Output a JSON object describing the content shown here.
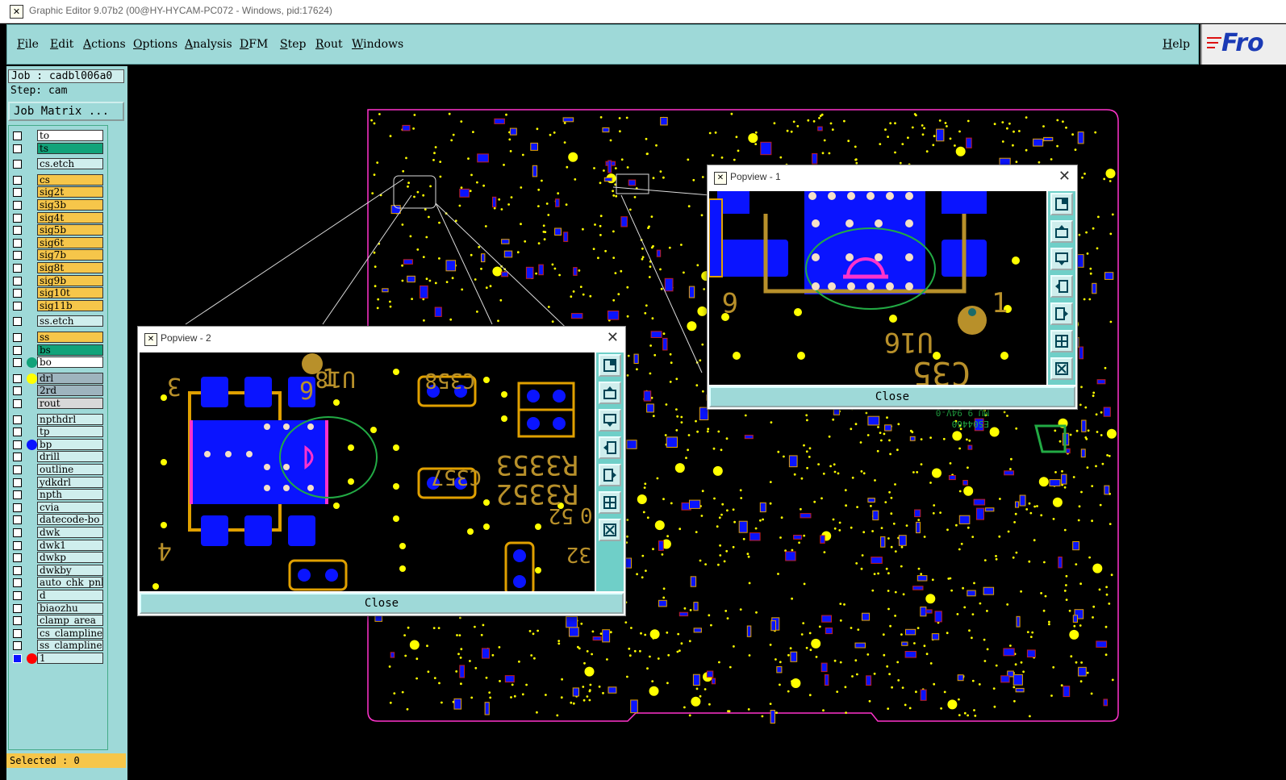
{
  "window": {
    "title": "Graphic Editor 9.07b2 (00@HY-HYCAM-PC072 - Windows, pid:17624)"
  },
  "menu": {
    "items": [
      "File",
      "Edit",
      "Actions",
      "Options",
      "Analysis",
      "DFM",
      "Step",
      "Rout",
      "Windows"
    ],
    "help": "Help"
  },
  "logo": {
    "text": "Fro"
  },
  "job": {
    "job_label": "Job : cadbl006a0",
    "step_label": "Step: cam",
    "matrix_button": "Job Matrix ..."
  },
  "layers": [
    {
      "name": "to",
      "color": "#ffffff"
    },
    {
      "name": "ts",
      "color": "#12a37a"
    },
    {
      "name": "cs.etch",
      "color": "#cfeeed"
    },
    {
      "name": "cs",
      "color": "#f6c64a"
    },
    {
      "name": "sig2t",
      "color": "#f6c64a"
    },
    {
      "name": "sig3b",
      "color": "#f6c64a"
    },
    {
      "name": "sig4t",
      "color": "#f6c64a"
    },
    {
      "name": "sig5b",
      "color": "#f6c64a"
    },
    {
      "name": "sig6t",
      "color": "#f6c64a"
    },
    {
      "name": "sig7b",
      "color": "#f6c64a"
    },
    {
      "name": "sig8t",
      "color": "#f6c64a"
    },
    {
      "name": "sig9b",
      "color": "#f6c64a"
    },
    {
      "name": "sig10t",
      "color": "#f6c64a"
    },
    {
      "name": "sig11b",
      "color": "#f6c64a"
    },
    {
      "name": "ss.etch",
      "color": "#cfeeed"
    },
    {
      "name": "ss",
      "color": "#f6c64a"
    },
    {
      "name": "bs",
      "color": "#12a37a"
    },
    {
      "name": "bo",
      "color": "#ffffff"
    },
    {
      "name": "drl",
      "color": "#9eb4be"
    },
    {
      "name": "2rd",
      "color": "#9eb4be"
    },
    {
      "name": "rout",
      "color": "#d8d8d8"
    },
    {
      "name": "npthdrl",
      "color": "#cfeeed"
    },
    {
      "name": "tp",
      "color": "#cfeeed"
    },
    {
      "name": "bp",
      "color": "#cfeeed"
    },
    {
      "name": "drill",
      "color": "#cfeeed"
    },
    {
      "name": "outline",
      "color": "#cfeeed"
    },
    {
      "name": "ydkdrl",
      "color": "#cfeeed"
    },
    {
      "name": "npth",
      "color": "#cfeeed"
    },
    {
      "name": "cvia",
      "color": "#cfeeed"
    },
    {
      "name": "datecode-bo",
      "color": "#cfeeed"
    },
    {
      "name": "dwk",
      "color": "#cfeeed"
    },
    {
      "name": "dwk1",
      "color": "#cfeeed"
    },
    {
      "name": "dwkp",
      "color": "#cfeeed"
    },
    {
      "name": "dwkby",
      "color": "#cfeeed"
    },
    {
      "name": "auto_chk_pnl",
      "color": "#cfeeed"
    },
    {
      "name": "d",
      "color": "#cfeeed"
    },
    {
      "name": "biaozhu",
      "color": "#cfeeed"
    },
    {
      "name": "clamp_area",
      "color": "#cfeeed"
    },
    {
      "name": "cs_clampline",
      "color": "#cfeeed"
    },
    {
      "name": "ss_clampline",
      "color": "#cfeeed"
    },
    {
      "name": "1",
      "color": "#cfeeed"
    }
  ],
  "status": {
    "selected": "Selected : 0"
  },
  "popview1": {
    "title": "Popview - 1",
    "close": "Close",
    "labels": [
      "6",
      "1",
      "U16",
      "C35"
    ]
  },
  "popview2": {
    "title": "Popview - 2",
    "close": "Close",
    "labels": [
      "3",
      "1",
      "4",
      "6",
      "U18",
      "C358",
      "C357",
      "R3353",
      "R3352",
      "0",
      "52",
      "32"
    ]
  },
  "board": {
    "silk_labels": [
      "ES04460",
      "MU 9 94V-0"
    ]
  },
  "colors": {
    "pad": "#0a14ff",
    "via": "#ffff00",
    "silk": "#b8902a",
    "trace": "#e0a000",
    "outline": "#ff33cc",
    "highlight": "#22aa44"
  }
}
